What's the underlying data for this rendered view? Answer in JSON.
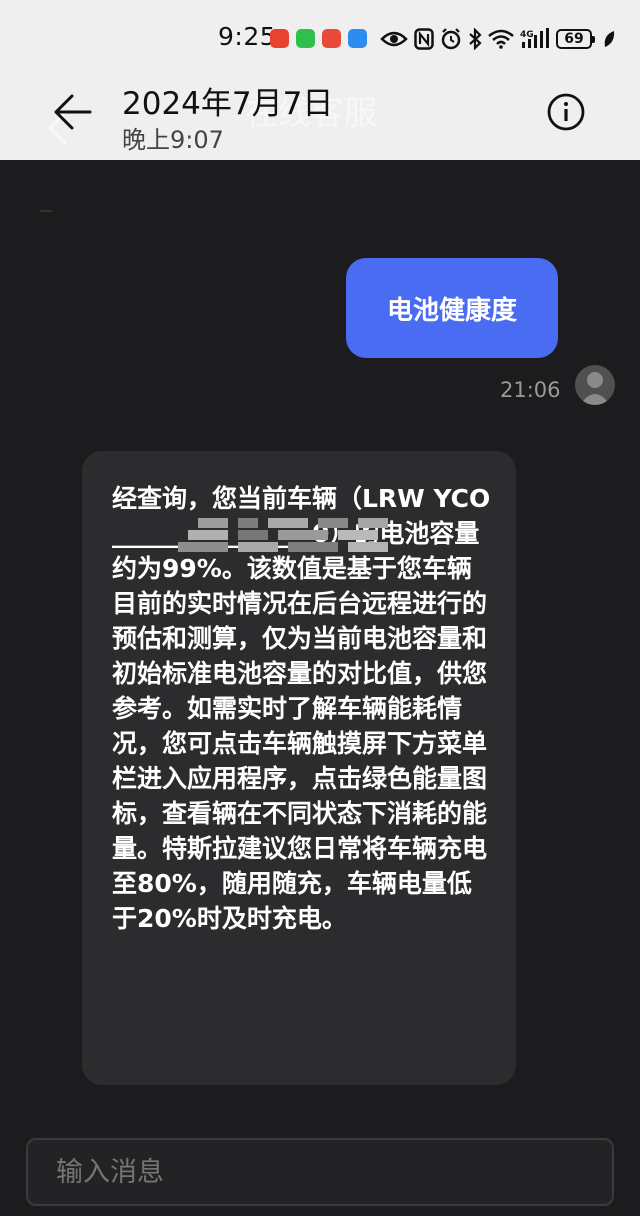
{
  "status_bar": {
    "time": "9:25",
    "battery": "69",
    "network": "4G"
  },
  "header": {
    "ghost_title": "在线客服",
    "date": "2024年7月7日",
    "time": "晚上9:07"
  },
  "messages": {
    "user": {
      "text": "电池健康度",
      "timestamp": "21:06"
    },
    "agent": {
      "text": "经查询，您当前车辆（LRW YCO________________0）的电池容量约为99%。该数值是基于您车辆目前的实时情况在后台远程进行的预估和测算，仅为当前电池容量和初始标准电池容量的对比值，供您参考。如需实时了解车辆能耗情况，您可点击车辆触摸屏下方菜单栏进入应用程序，点击绿色能量图标，查看辆在不同状态下消耗的能量。特斯拉建议您日常将车辆充电至80%，随用随充，车辆电量低于20%时及时充电。"
    }
  },
  "input": {
    "placeholder": "输入消息"
  },
  "colors": {
    "accent": "#4a6cf2",
    "background": "#1c1c1e",
    "bubble": "#2c2c2e",
    "header": "#efefef"
  }
}
